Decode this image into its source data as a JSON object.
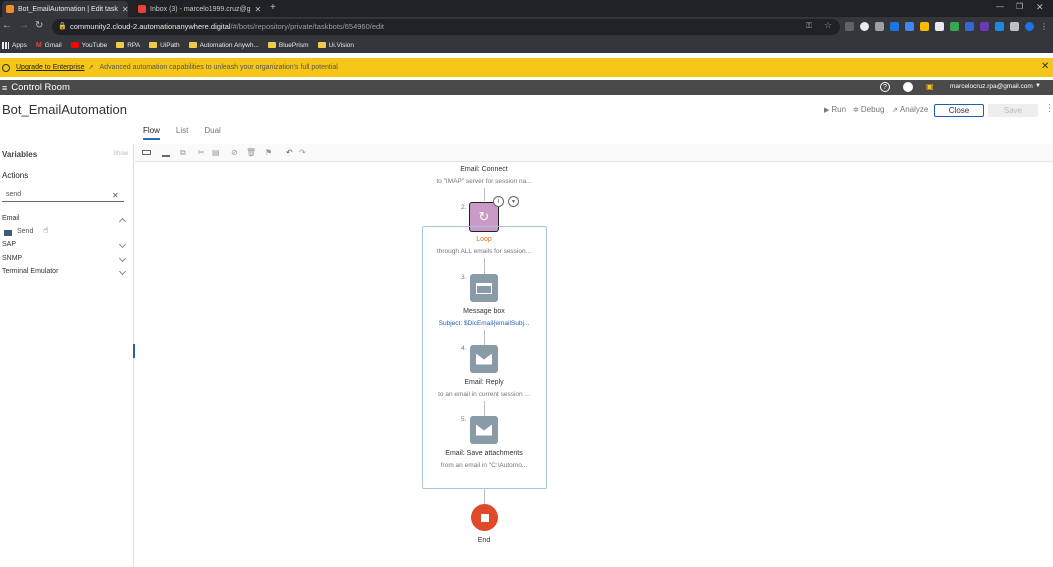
{
  "browser": {
    "tabs": [
      {
        "title": "Bot_EmailAutomation | Edit task",
        "active": true
      },
      {
        "title": "Inbox (3) - marcelo1999.cruz@g",
        "active": false
      }
    ],
    "url_host": "community2.cloud-2.automationanywhere.digital",
    "url_path": "/#/bots/repository/private/taskbots/654960/edit",
    "bookmarks": [
      "Apps",
      "Gmail",
      "YouTube",
      "RPA",
      "UiPath",
      "Automation Anywh...",
      "BluePrism",
      "Ui.Vision"
    ]
  },
  "banner": {
    "link": "Upgrade to Enterprise",
    "text": "Advanced automation capabilities to unleash your organization's full potential"
  },
  "app": {
    "name": "Control Room",
    "user": "marcelocruz.rpa@gmail.com"
  },
  "editor": {
    "bot_title": "Bot_EmailAutomation",
    "run": "Run",
    "debug": "Debug",
    "analyze": "Analyze",
    "close": "Close",
    "save": "Save",
    "view_tabs": [
      "Flow",
      "List",
      "Dual"
    ]
  },
  "left_panel": {
    "variables": "Variables",
    "show": "Show",
    "actions": "Actions",
    "search_value": "send",
    "groups": [
      "Email",
      "SAP",
      "SNMP",
      "Terminal Emulator"
    ],
    "email_item": "Send"
  },
  "flow": {
    "connect_title": "Email: Connect",
    "connect_sub": "to \"IMAP\" server for session na...",
    "loop_num": "2.",
    "loop_title": "Loop",
    "loop_sub": "through ALL emails for session...",
    "msgbox_num": "3.",
    "msgbox_title": "Message box",
    "msgbox_sub": "Subject: $DicEmail{emailSubj...",
    "reply_num": "4.",
    "reply_title": "Email: Reply",
    "reply_sub": "to an email in current session ...",
    "save_num": "5.",
    "save_title": "Email: Save attachments",
    "save_sub": "from an email in \"C:\\Automo...",
    "end_title": "End"
  }
}
